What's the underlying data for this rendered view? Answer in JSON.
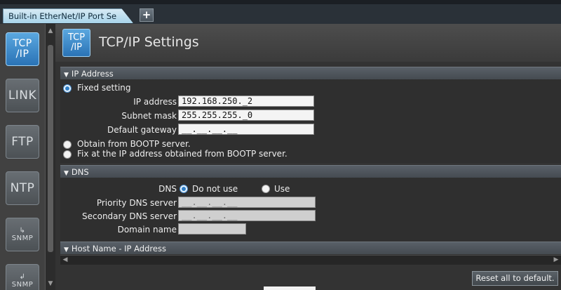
{
  "tabs": {
    "active_label": "Built-in EtherNet/IP Port Se",
    "add_label": "+"
  },
  "sidebar": {
    "items": [
      {
        "label": "TCP /IP"
      },
      {
        "label": "LINK"
      },
      {
        "label": "FTP"
      },
      {
        "label": "NTP"
      },
      {
        "label": "SNMP"
      },
      {
        "label": "SNMP"
      }
    ]
  },
  "header": {
    "icon_label": "TCP /IP",
    "title": "TCP/IP Settings"
  },
  "ip_section": {
    "title": "IP Address",
    "fixed_label": "Fixed setting",
    "ip_label": "IP address",
    "ip_value": "192.168.250._2",
    "subnet_label": "Subnet mask",
    "subnet_value": "255.255.255._0",
    "gateway_label": "Default gateway",
    "gateway_value": "__.__.__.__",
    "bootp_label": "Obtain from BOOTP server.",
    "fixbootp_label": "Fix at the IP address obtained from BOOTP server."
  },
  "dns_section": {
    "title": "DNS",
    "dns_label": "DNS",
    "do_not_use": "Do not use",
    "use": "Use",
    "priority_label": "Priority DNS server",
    "priority_value": "__.__.__.__",
    "secondary_label": "Secondary DNS server",
    "secondary_value": "__.__.__.__",
    "domain_label": "Domain name",
    "domain_value": ""
  },
  "host_section": {
    "title": "Host Name - IP Address"
  },
  "footer": {
    "reset_label": "Reset all to default."
  }
}
